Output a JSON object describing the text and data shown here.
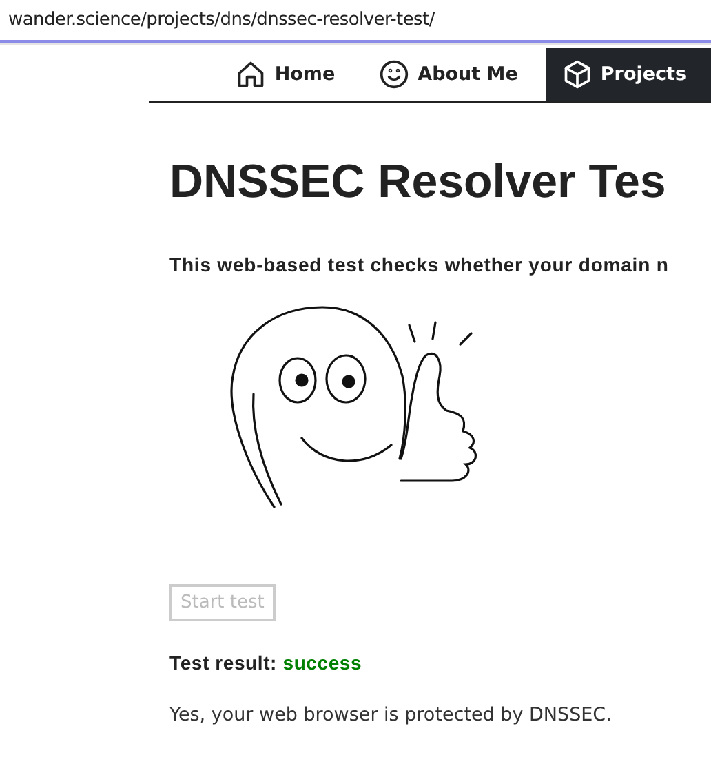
{
  "address_bar": {
    "url": "wander.science/projects/dns/dnssec-resolver-test/"
  },
  "nav": [
    {
      "label": "Home",
      "selected": false
    },
    {
      "label": "About Me",
      "selected": false
    },
    {
      "label": "Projects",
      "selected": true
    }
  ],
  "title": "DNSSEC Resolver Tes",
  "intro": "This web-based test checks whether your domain n",
  "start_button": {
    "label": "Start test",
    "disabled": true
  },
  "result": {
    "label": "Test result:",
    "value": "success"
  },
  "message": "Yes, your web browser is protected by DNSSEC."
}
